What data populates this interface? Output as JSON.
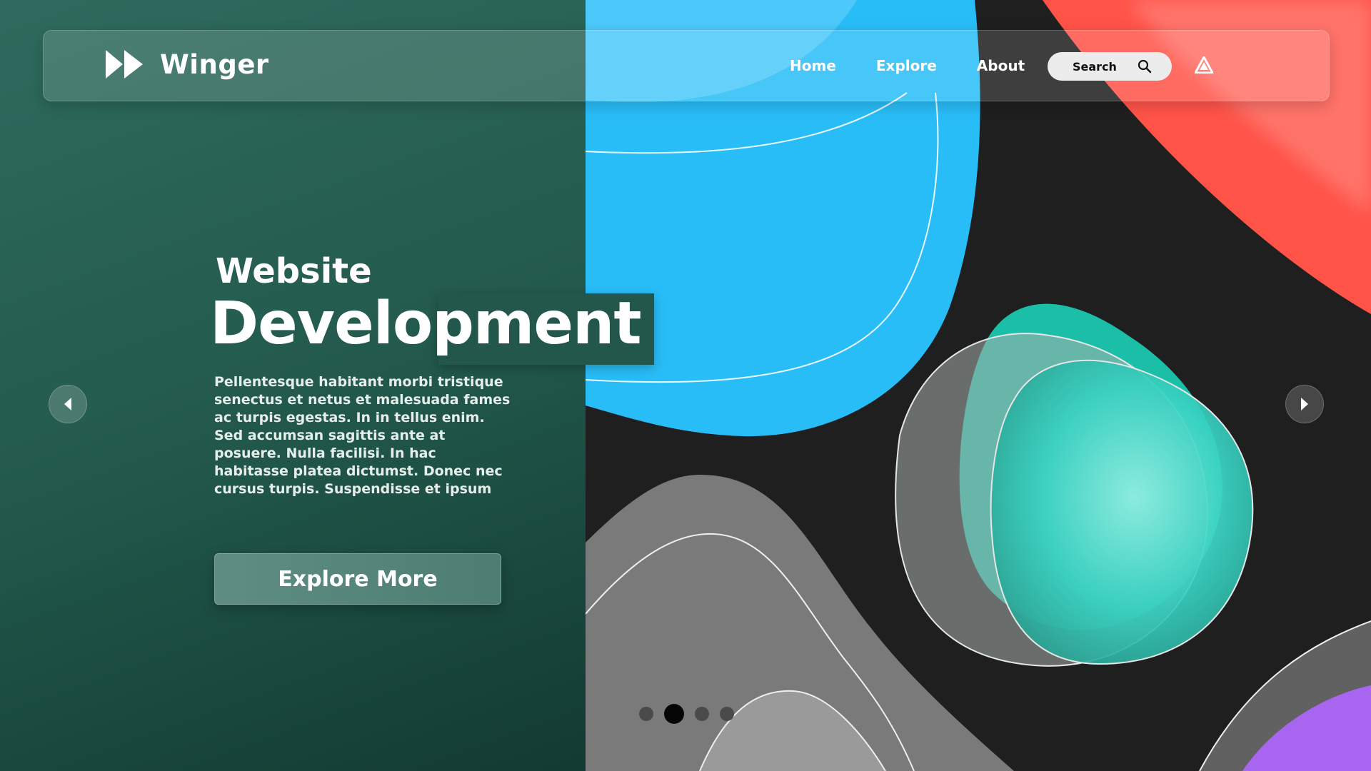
{
  "brand": {
    "name": "Winger",
    "logo_icon": "double-play-icon"
  },
  "nav": {
    "links": [
      "Home",
      "Explore",
      "About"
    ],
    "search_label": "Search",
    "search_icon": "search-icon",
    "brand_mark_icon": "triangle-logo-icon"
  },
  "hero": {
    "subtitle": "Website",
    "title": "Development",
    "body": "Pellentesque habitant morbi tristique senectus et netus et malesuada  fames ac turpis egestas. In in tellus enim. Sed accumsan sagittis ante  at posuere. Nulla facilisi. In hac habitasse platea dictumst. Donec nec  cursus turpis. Suspendisse et ipsum",
    "cta_label": "Explore More"
  },
  "carousel": {
    "prev_icon": "chevron-left-icon",
    "next_icon": "chevron-right-icon",
    "total_slides": 4,
    "active_index": 2
  },
  "colors": {
    "green_panel": "#2e6b5e",
    "blue_shape": "#29bdf7",
    "red_shape": "#ff5348",
    "teal_shape": "#3ed6c6",
    "purple_shape": "#a865f0",
    "background_dark": "#1f1f1f"
  }
}
